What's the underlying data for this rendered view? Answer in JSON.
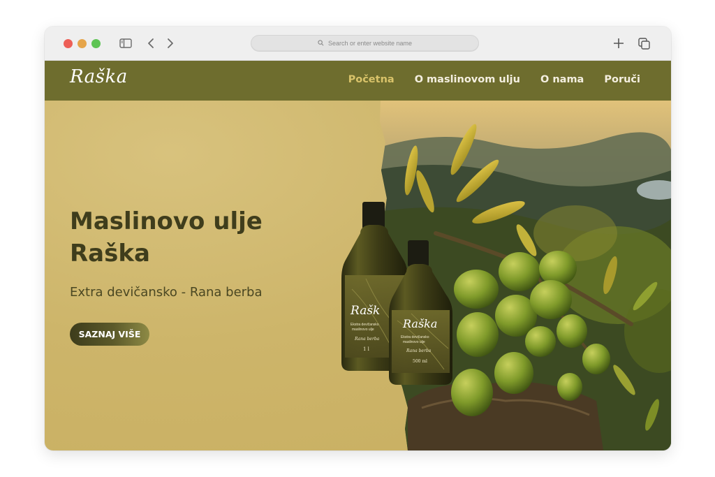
{
  "browser": {
    "address_placeholder": "Search or enter website name",
    "icons": [
      "sidebar-icon",
      "chevron-left-icon",
      "chevron-right-icon",
      "search-icon",
      "plus-icon",
      "tabs-icon"
    ]
  },
  "site": {
    "logo": "Raška",
    "nav": [
      {
        "label": "Početna",
        "active": true
      },
      {
        "label": "O maslinovom ulju",
        "active": false
      },
      {
        "label": "O nama",
        "active": false
      },
      {
        "label": "Poruči",
        "active": false
      }
    ]
  },
  "hero": {
    "title_line1": "Maslinovo ulje",
    "title_line2": "Raška",
    "subtitle": "Extra devičansko - Rana berba",
    "cta": "SAZNAJ VIŠE"
  },
  "bottles": {
    "large": {
      "brand": "Raška",
      "type": "Ekstra devičansko maslinovo ulje",
      "harvest": "Rana berba",
      "volume": "1 l"
    },
    "small": {
      "brand": "Raška",
      "type": "Ekstra devičansko maslinovo ulje",
      "harvest": "Rana berba",
      "volume": "500 ml"
    }
  },
  "colors": {
    "nav_bg": "#6e6d2e",
    "accent": "#d9c36a",
    "hero_bg": "#cdb56a",
    "text_dark": "#3f3d1c"
  }
}
